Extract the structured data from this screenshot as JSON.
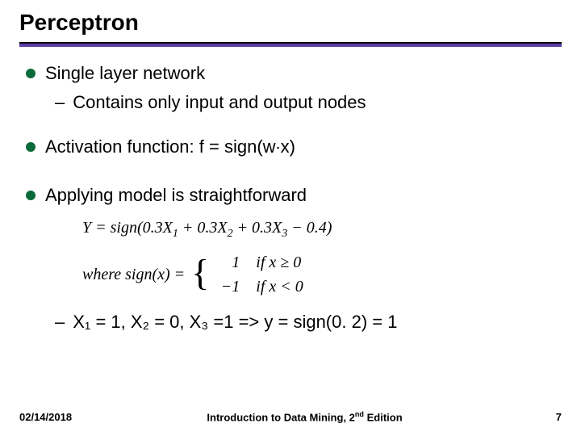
{
  "title": "Perceptron",
  "bullets": {
    "b1": "Single layer network",
    "b1_sub": "Contains only input and output nodes",
    "b2": "Activation function:  f = sign(w∙x)",
    "b3": "Applying model is straightforward"
  },
  "formula": {
    "y_eq": "Y = sign(0.3X",
    "y_eq_after1": " + 0.3X",
    "y_eq_after2": " + 0.3X",
    "y_eq_after3": " − 0.4)",
    "where": "where sign(x) =",
    "case1_val": "1",
    "case1_cond": "if x ≥ 0",
    "case2_val": "−1",
    "case2_cond": "if x < 0"
  },
  "example": {
    "text": "X₁ = 1, X₂ = 0, X₃ =1 => y = sign(0. 2) = 1"
  },
  "footer": {
    "date": "02/14/2018",
    "center_pre": "Introduction to Data Mining, 2",
    "center_suf": " Edition",
    "page": "7"
  }
}
